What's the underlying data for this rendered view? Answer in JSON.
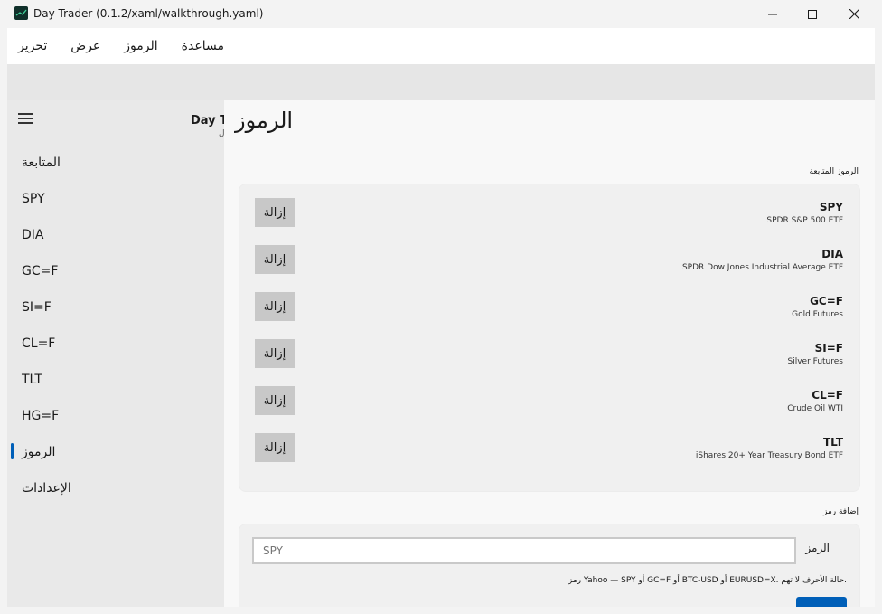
{
  "window": {
    "title": "Day Trader (0.1.2/xaml/walkthrough.yaml)"
  },
  "menu": [
    "تحرير",
    "عرض",
    "الرموز",
    "مساعدة"
  ],
  "nav": {
    "items": [
      "المتابعة",
      "SPY",
      "DIA",
      "GC=F",
      "SI=F",
      "CL=F",
      "TLT",
      "HG=F",
      "الرموز",
      "الإعدادات"
    ],
    "selected": "الرموز",
    "ghost_title": "Day Tr",
    "ghost_sub": "ل"
  },
  "page": {
    "title": "الرموز",
    "watched_label": "الرموز المتابعة",
    "remove_label": "إزالة",
    "symbols": [
      {
        "symbol": "SPY",
        "name": "SPDR S&P 500 ETF"
      },
      {
        "symbol": "DIA",
        "name": "SPDR Dow Jones Industrial Average ETF"
      },
      {
        "symbol": "GC=F",
        "name": "Gold Futures"
      },
      {
        "symbol": "SI=F",
        "name": "Silver Futures"
      },
      {
        "symbol": "CL=F",
        "name": "Crude Oil WTI"
      },
      {
        "symbol": "TLT",
        "name": "iShares 20+ Year Treasury Bond ETF"
      }
    ],
    "add_section_label": "إضافة رمز",
    "input_label": "الرمز",
    "input_placeholder": "SPY",
    "help_text": "رمز Yahoo — SPY أو GC=F أو BTC-USD أو EURUSD=X. حالة الأحرف لا تهم."
  },
  "colors": {
    "accent": "#005fb8",
    "remove_button": "#c8c8c8"
  }
}
